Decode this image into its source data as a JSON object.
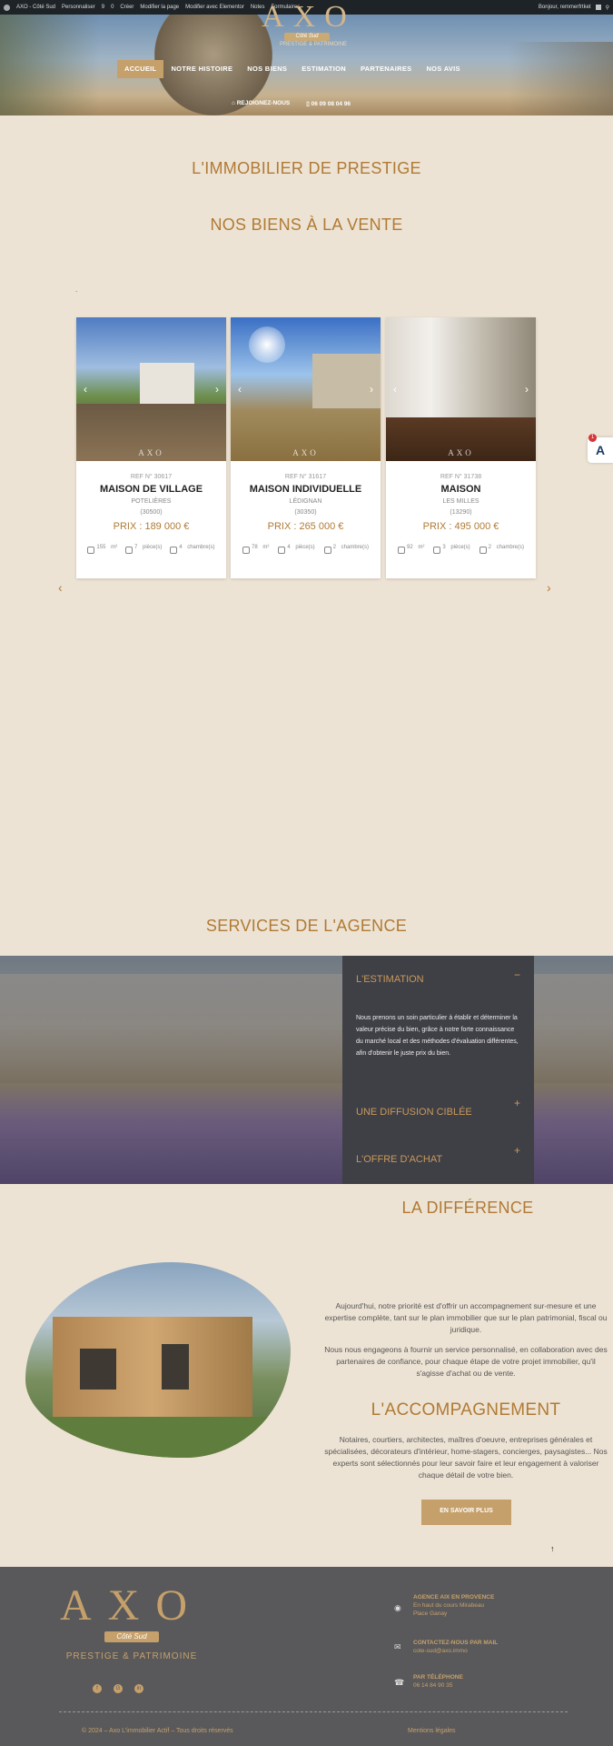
{
  "admin_bar": {
    "items": [
      "AXO - Côté Sud",
      "Personnaliser",
      "9",
      "0",
      "Créer",
      "Modifier la page",
      "Modifier avec Elementor",
      "Notes",
      "Formulaires"
    ],
    "greeting": "Bonjour, remmerfrtket"
  },
  "header": {
    "logo": "AXO",
    "logo_sub": "Côté Sud",
    "logo_tagline": "PRESTIGE & PATRIMOINE",
    "nav": [
      "ACCUEIL",
      "NOTRE HISTOIRE",
      "NOS BIENS",
      "ESTIMATION",
      "PARTENAIRES",
      "NOS AVIS"
    ],
    "active_nav": "ACCUEIL",
    "contact_label": "REJOIGNEZ-NOUS",
    "phone": "06 09 08 04 96"
  },
  "intro": {
    "title": "L'IMMOBILIER DE PRESTIGE",
    "subtitle": "NOS BIENS À LA VENTE",
    "dot": "."
  },
  "listings": [
    {
      "ref": "REF N° 30617",
      "title": "MAISON DE VILLAGE",
      "city": "POTELIÈRES",
      "zip": "(30500)",
      "price": "PRIX : 189 000 €",
      "surface": "155",
      "surface_unit": "m²",
      "rooms": "7",
      "rooms_unit": "pièce(s)",
      "bedrooms": "4",
      "bedrooms_unit": "chambre(s)",
      "photo": "village-stone-house"
    },
    {
      "ref": "REF N° 31617",
      "title": "MAISON INDIVIDUELLE",
      "city": "LÉDIGNAN",
      "zip": "(30350)",
      "price": "PRIX : 265 000 €",
      "surface": "78",
      "surface_unit": "m²",
      "rooms": "4",
      "rooms_unit": "pièce(s)",
      "bedrooms": "2",
      "bedrooms_unit": "chambre(s)",
      "photo": "garden-sunny-house"
    },
    {
      "ref": "REF N° 31738",
      "title": "MAISON",
      "city": "LES MILLES",
      "zip": "(13290)",
      "price": "PRIX : 495 000 €",
      "surface": "92",
      "surface_unit": "m²",
      "rooms": "3",
      "rooms_unit": "pièce(s)",
      "bedrooms": "2",
      "bedrooms_unit": "chambre(s)",
      "photo": "interior-room"
    }
  ],
  "photo_watermark": "AXO",
  "services": {
    "title": "SERVICES DE L'AGENCE",
    "items": [
      {
        "label": "L'ESTIMATION",
        "toggle": "−",
        "body": "Nous prenons un soin particulier à établir et déterminer la valeur précise du bien, grâce à notre forte connaissance du marché local et des méthodes d'évaluation différentes, afin d'obtenir le juste prix du bien."
      },
      {
        "label": "UNE DIFFUSION CIBLÉE",
        "toggle": "+"
      },
      {
        "label": "L'OFFRE D'ACHAT",
        "toggle": "+"
      }
    ]
  },
  "difference": {
    "title": "LA DIFFÉRENCE",
    "p1": "Aujourd'hui, notre priorité est d'offrir un accompagnement sur-mesure et une expertise complète, tant sur le plan immobilier que sur le plan patrimonial, fiscal ou juridique.",
    "p2": "Nous nous engageons à fournir un service personnalisé, en collaboration avec des partenaires de confiance, pour chaque étape de votre projet immobilier, qu'il s'agisse d'achat ou de vente.",
    "title2": "L'ACCOMPAGNEMENT",
    "p3": "Notaires, courtiers, architectes, maîtres d'oeuvre, entreprises générales et spécialisées, décorateurs d'intérieur, home-stagers, concierges, paysagistes... Nos experts sont sélectionnés pour leur savoir faire et leur engagement à valoriser chaque détail de votre bien.",
    "button": "EN SAVOIR PLUS"
  },
  "footer": {
    "logo": "AXO",
    "logo_sub": "Côté Sud",
    "tagline": "PRESTIGE & PATRIMOINE",
    "socials": [
      "facebook-icon",
      "google-icon",
      "linkedin-icon"
    ],
    "agency_label": "AGENCE AIX EN PROVENCE",
    "agency_addr1": "En haut du cours Mirabeau",
    "agency_addr2": "Place Ganay",
    "contact_label": "CONTACTEZ-NOUS PAR MAIL",
    "contact_mail": "cote-sud@axo.immo",
    "phone_label": "PAR TÉLÉPHONE",
    "phone": "06 14 84 90 35",
    "copyright": "© 2024 – Axo L'immobilier Actif – Tous droits réservés",
    "legal": "Mentions légales"
  },
  "widget": {
    "badge": "1",
    "letter": "A"
  },
  "colors": {
    "gold": "#b07a34",
    "accent": "#c6a06b",
    "bg": "#ede3d4",
    "footer": "#59595b"
  }
}
